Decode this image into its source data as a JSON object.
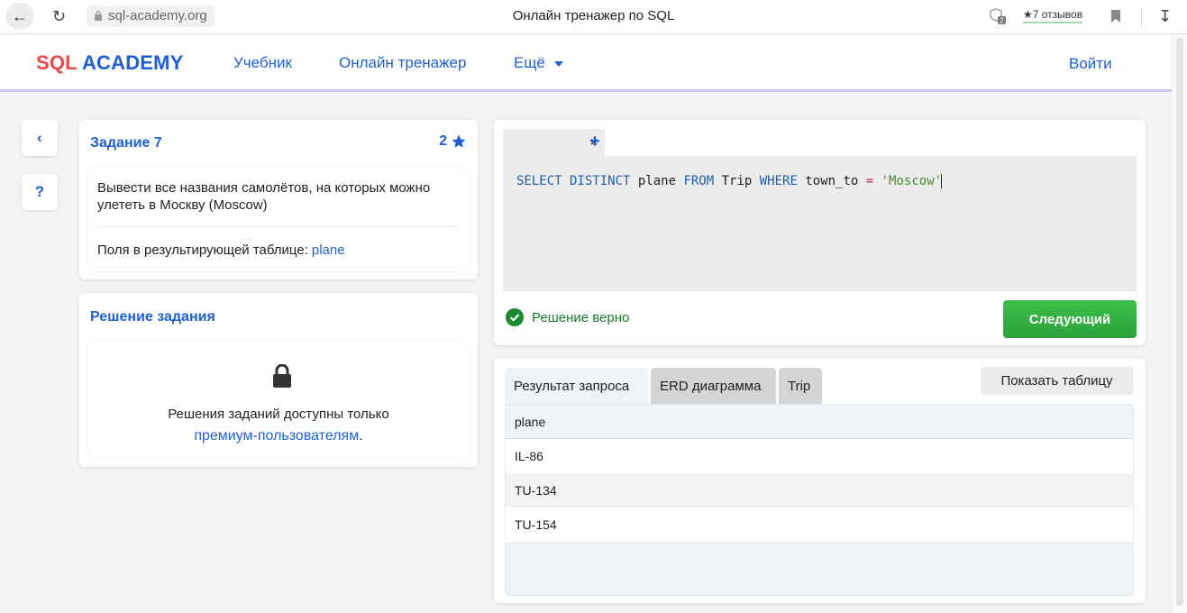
{
  "browser": {
    "url": "sql-academy.org",
    "title": "Онлайн тренажер по SQL",
    "extension_badge": "2",
    "reviews": "★7 отзывов"
  },
  "header": {
    "logo_sql": "SQL",
    "logo_academy": "ACADEMY",
    "nav": [
      "Учебник",
      "Онлайн тренажер",
      "Ещё"
    ],
    "login": "Войти"
  },
  "sidebar": {
    "back": "‹",
    "help": "?"
  },
  "task": {
    "title": "Задание 7",
    "score": "2",
    "description": "Вывести все названия самолётов, на которых можно улететь в Москву (Moscow)",
    "fields_label": "Поля в результирующей таблице:",
    "fields_value": "plane"
  },
  "solution": {
    "title": "Решение задания",
    "message_line1": "Решения заданий доступны только",
    "message_link": "премиум-пользователям",
    "message_end": "."
  },
  "editor": {
    "tab_close": "×",
    "add_tab": "+",
    "code": {
      "t1": "SELECT DISTINCT",
      "t2": " plane ",
      "t3": "FROM",
      "t4": " Trip ",
      "t5": "WHERE",
      "t6": " town_to ",
      "t7": "=",
      "t8": " 'Moscow'"
    },
    "status": "Решение верно",
    "next_button": "Следующий"
  },
  "result": {
    "tabs": [
      "Результат запроса",
      "ERD диаграмма",
      "Trip"
    ],
    "show_table_button": "Показать таблицу",
    "columns": [
      "plane"
    ],
    "rows": [
      "IL-86",
      "TU-134",
      "TU-154"
    ]
  },
  "colors": {
    "accent": "#1f5fd6",
    "logo_red": "#e5484d",
    "success": "#2aa33a"
  }
}
